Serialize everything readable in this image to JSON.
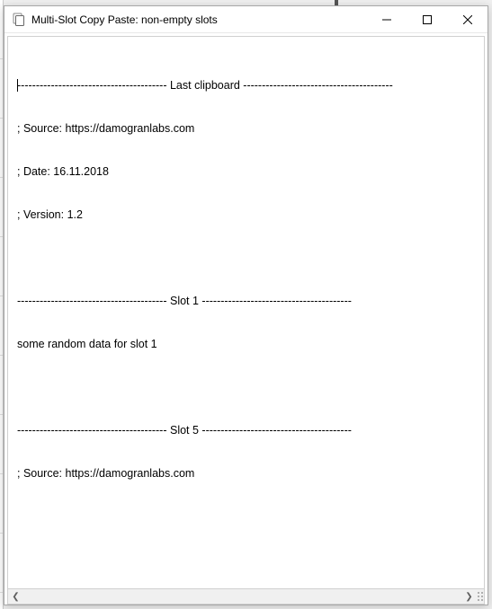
{
  "window": {
    "title": "Multi-Slot Copy Paste: non-empty slots"
  },
  "sections": {
    "last_clipboard": {
      "header": "---------------------------------------- Last clipboard ----------------------------------------",
      "lines": [
        "; Source: https://damogranlabs.com",
        "; Date: 16.11.2018",
        "; Version: 1.2"
      ]
    },
    "slot1": {
      "header": "---------------------------------------- Slot 1 ----------------------------------------",
      "lines": [
        "some random data for slot 1"
      ]
    },
    "slot5": {
      "header": "---------------------------------------- Slot 5 ----------------------------------------",
      "lines": [
        "; Source: https://damogranlabs.com"
      ]
    }
  },
  "scrollbar": {
    "left_glyph": "❮",
    "right_glyph": "❯"
  }
}
